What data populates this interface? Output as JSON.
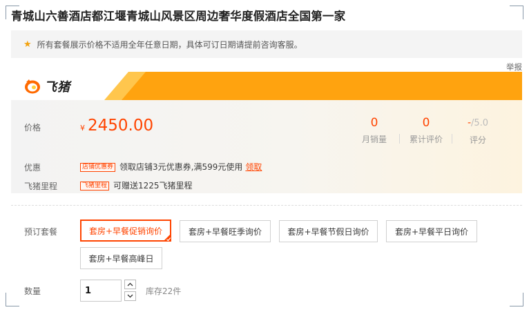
{
  "title": "青城山六善酒店都江堰青城山风景区周边奢华度假酒店全国第一家",
  "notice": "所有套餐展示价格不适用全年任意日期，具体可订日期请提前咨询客服。",
  "report_label": "举报",
  "brand": {
    "name": "飞猪",
    "accent": "#ffa30f",
    "accent_light": "#ffc64d"
  },
  "price": {
    "label": "价格",
    "currency": "¥",
    "value": "2450.00",
    "color": "#ff4400"
  },
  "stats": [
    {
      "value": "0",
      "caption": "月销量"
    },
    {
      "value": "0",
      "caption": "累计评价"
    },
    {
      "value": "-",
      "suffix": "/5.0",
      "caption": "评分"
    }
  ],
  "promo": {
    "label": "优惠",
    "tag": "店铺优惠券",
    "text": "领取店铺3元优惠券,满599元使用",
    "link": "领取"
  },
  "miles": {
    "label": "飞猪里程",
    "tag": "飞猪里程",
    "text": "可赠送1225飞猪里程"
  },
  "packages": {
    "label": "预订套餐",
    "options": [
      {
        "label": "套房+早餐促销询价",
        "selected": true
      },
      {
        "label": "套房+早餐旺季询价",
        "selected": false
      },
      {
        "label": "套房+早餐节假日询价",
        "selected": false
      },
      {
        "label": "套房+早餐平日询价",
        "selected": false
      },
      {
        "label": "套房+早餐高峰日",
        "selected": false
      }
    ]
  },
  "quantity": {
    "label": "数量",
    "value": "1",
    "stock": "库存22件"
  },
  "icons": {
    "notice": "star-icon",
    "step_up": "chevron-up-icon",
    "step_down": "chevron-down-icon",
    "selected": "check-corner-icon",
    "logo": "fliggy-logo-icon"
  }
}
